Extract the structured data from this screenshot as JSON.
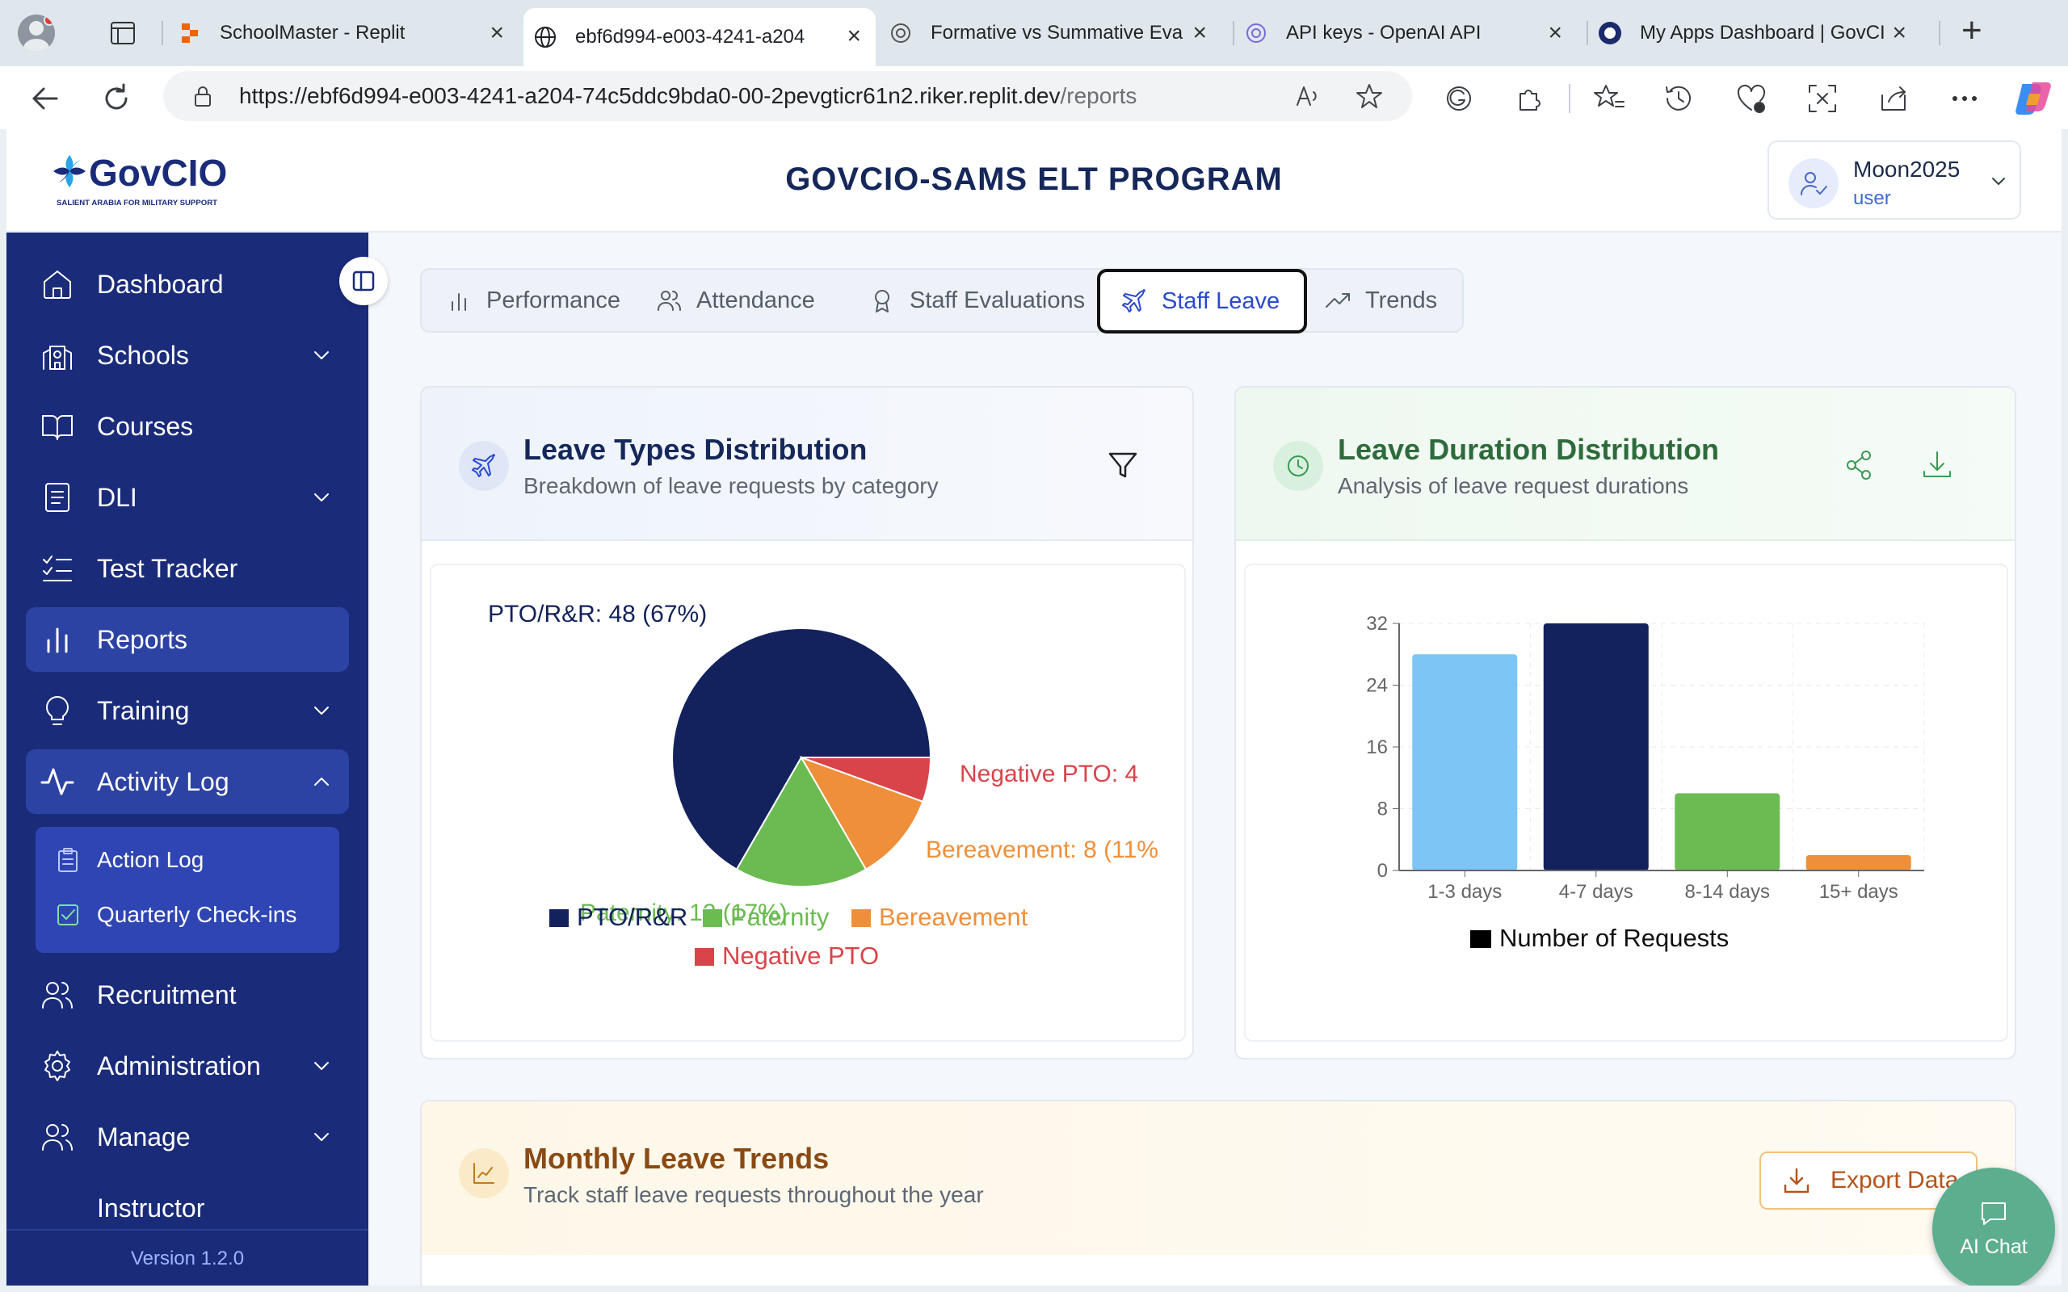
{
  "browser": {
    "tabs": [
      {
        "title": "",
        "icon": "profile-avatar-icon"
      },
      {
        "title": "SchoolMaster - Replit",
        "icon": "replit-icon"
      },
      {
        "title": "ebf6d994-e003-4241-a204",
        "icon": "globe-icon"
      },
      {
        "title": "Formative vs Summative Eva",
        "icon": "openai-icon"
      },
      {
        "title": "API keys - OpenAI API",
        "icon": "openai-icon"
      },
      {
        "title": "My Apps Dashboard | GovCI",
        "icon": "okta-icon"
      }
    ],
    "url_main": "https://ebf6d994-e003-4241-a204-74c5ddc9bda0-00-2pevgticr61n2.riker.replit.dev",
    "url_path": "/reports"
  },
  "header": {
    "logo_text": "GovCIO",
    "logo_tagline": "SALIENT ARABIA FOR MILITARY SUPPORT",
    "title": "GOVCIO-SAMS ELT PROGRAM",
    "user_name": "Moon2025",
    "user_role": "user"
  },
  "sidebar": {
    "items": [
      {
        "label": "Dashboard",
        "icon": "home-icon"
      },
      {
        "label": "Schools",
        "icon": "school-icon"
      },
      {
        "label": "Courses",
        "icon": "book-open-icon"
      },
      {
        "label": "DLI",
        "icon": "notebook-icon"
      },
      {
        "label": "Test Tracker",
        "icon": "checklist-icon"
      },
      {
        "label": "Reports",
        "icon": "bar-chart-icon"
      },
      {
        "label": "Training",
        "icon": "lightbulb-icon"
      },
      {
        "label": "Activity Log",
        "icon": "activity-icon"
      },
      {
        "label": "Recruitment",
        "icon": "users-icon"
      },
      {
        "label": "Administration",
        "icon": "gear-icon"
      },
      {
        "label": "Manage",
        "icon": "users-icon"
      },
      {
        "label": "Instructor",
        "icon": ""
      }
    ],
    "subitems": [
      {
        "label": "Action Log",
        "icon": "clipboard-icon"
      },
      {
        "label": "Quarterly Check-ins",
        "icon": "check-square-icon"
      }
    ],
    "version": "Version 1.2.0"
  },
  "report_tabs": [
    {
      "label": "Performance",
      "icon": "bar-chart-icon"
    },
    {
      "label": "Attendance",
      "icon": "users-icon"
    },
    {
      "label": "Staff Evaluations",
      "icon": "award-icon"
    },
    {
      "label": "Staff Leave",
      "icon": "plane-icon"
    },
    {
      "label": "Trends",
      "icon": "trending-up-icon"
    }
  ],
  "leave_types_card": {
    "title": "Leave Types Distribution",
    "subtitle": "Breakdown of leave requests by category",
    "pie_labels": {
      "pto": "PTO/R&R: 48 (67%)",
      "negative": "Negative PTO: 4",
      "bereavement": "Bereavement: 8 (11%",
      "paternity": "Paternity: 12 (17%)"
    },
    "legend": {
      "pto": "PTO/R&R",
      "paternity": "Paternity",
      "bereavement": "Bereavement",
      "negative": "Negative PTO"
    }
  },
  "leave_duration_card": {
    "title": "Leave Duration Distribution",
    "subtitle": "Analysis of leave request durations",
    "legend": "Number of Requests",
    "yticks": [
      "0",
      "8",
      "16",
      "24",
      "32"
    ],
    "xticks": [
      "1-3 days",
      "4-7 days",
      "8-14 days",
      "15+ days"
    ]
  },
  "monthly_card": {
    "title": "Monthly Leave Trends",
    "subtitle": "Track staff leave requests throughout the year",
    "export_label": "Export Data"
  },
  "ai_chat_label": "AI Chat",
  "colors": {
    "sidebar": "#1a2b7a",
    "pto": "#13225c",
    "paternity": "#6cbb52",
    "bereavement": "#ef8f3a",
    "negative": "#d9444a",
    "bar1": "#7cc5f5"
  },
  "chart_data": [
    {
      "type": "pie",
      "title": "Leave Types Distribution",
      "categories": [
        "PTO/R&R",
        "Paternity",
        "Bereavement",
        "Negative PTO"
      ],
      "values": [
        48,
        12,
        8,
        4
      ],
      "legend": "bottom"
    },
    {
      "type": "bar",
      "title": "Leave Duration Distribution",
      "categories": [
        "1-3 days",
        "4-7 days",
        "8-14 days",
        "15+ days"
      ],
      "series": [
        {
          "name": "Number of Requests",
          "values": [
            28,
            32,
            10,
            2
          ]
        }
      ],
      "ylim": [
        0,
        32
      ],
      "yticks": [
        0,
        8,
        16,
        24,
        32
      ],
      "grid": true,
      "legend": "bottom"
    }
  ]
}
